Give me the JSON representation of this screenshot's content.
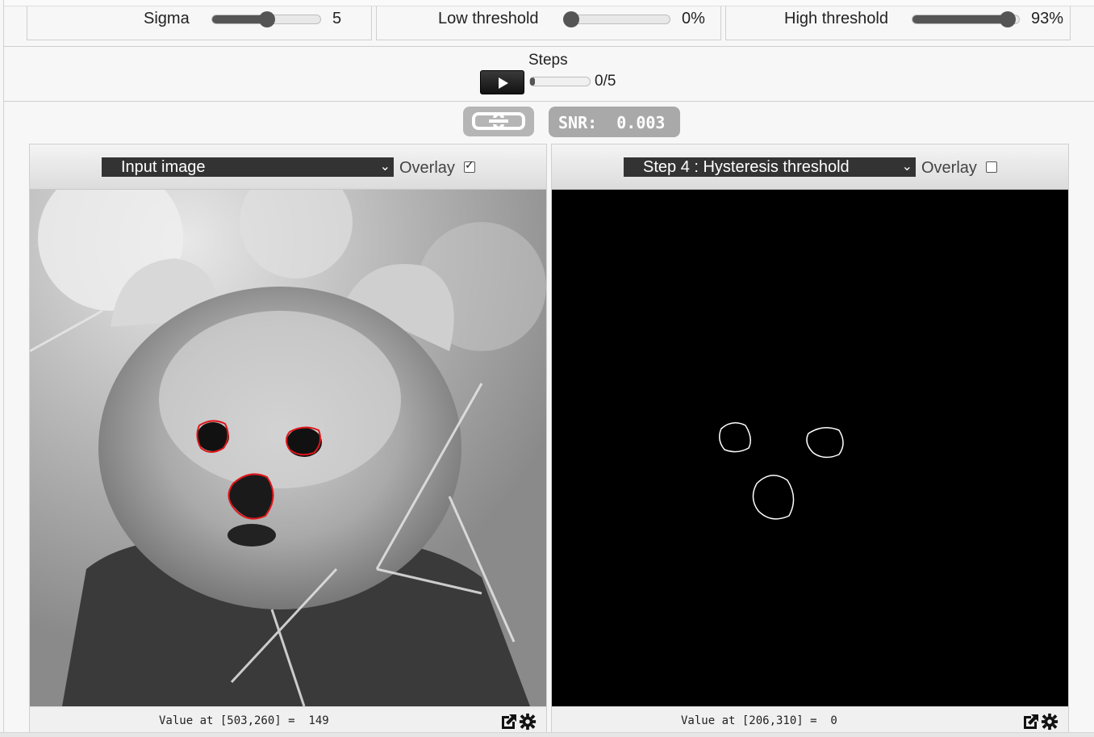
{
  "params": {
    "sigma": {
      "label": "Sigma",
      "value": "5",
      "level": 0.5
    },
    "low": {
      "label": "Low threshold",
      "value": "0%",
      "level": 0.0
    },
    "high": {
      "label": "High threshold",
      "value": "93%",
      "level": 0.93
    }
  },
  "steps": {
    "title": "Steps",
    "count": "0/5",
    "progress": 0.0
  },
  "snr": {
    "text": "SNR:  0.003"
  },
  "left_panel": {
    "select": "Input image",
    "overlay_label": "Overlay",
    "overlay_checked": true,
    "readout": "Value at [503,260] =  149"
  },
  "right_panel": {
    "select": "Step 4 : Hysteresis threshold",
    "overlay_label": "Overlay",
    "overlay_checked": false,
    "readout": "Value at [206,310] =  0"
  },
  "colors": {
    "edge_overlay": "#e0161a",
    "panel_bg": "#000000",
    "button_dark": "#222222"
  },
  "icons": [
    "play-icon",
    "link-icon",
    "external-link-icon",
    "gear-icon",
    "chevron-down-icon",
    "checkbox-icon"
  ]
}
